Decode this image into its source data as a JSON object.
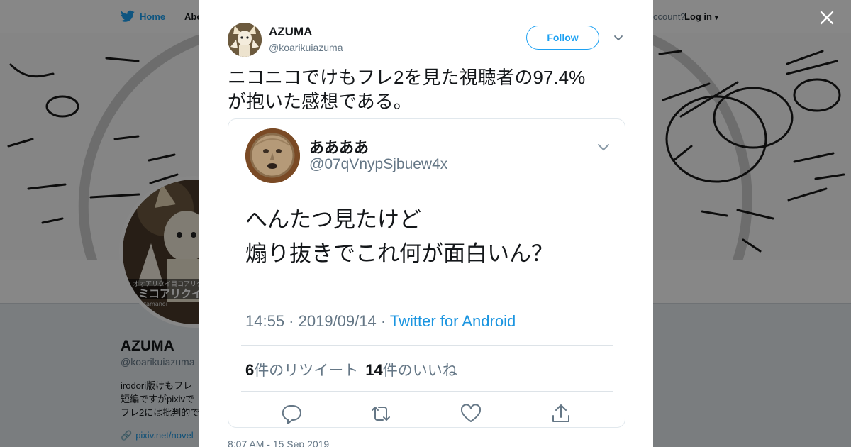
{
  "background": {
    "nav": {
      "home_label": "Home",
      "about_label": "Abo",
      "account_label": "ccount?",
      "login_label": "Log in"
    },
    "profile": {
      "avatar_caption_top": "オオアリクイ目コアリクイ属",
      "avatar_caption_main": "ミコアリクイ",
      "avatar_caption_sub": "tamanoi",
      "name": "AZUMA",
      "handle": "@koarikuiazuma",
      "bio_lines": [
        "irodori版けもフレ",
        "短編ですがpixivで",
        "フレ2には批判的で"
      ],
      "link": "pixiv.net/novel"
    }
  },
  "modal": {
    "author": {
      "name": "AZUMA",
      "handle": "@koarikuiazuma"
    },
    "follow_label": "Follow",
    "tweet_text_lines": [
      "ニコニコでけもフレ2を見た視聴者の97.4%",
      "が抱いた感想である。"
    ],
    "embedded_screenshot": {
      "name": "ああああ",
      "handle": "@07qVnypSjbuew4x",
      "text_lines": [
        "へんたつ見たけど",
        "煽り抜きでこれ何が面白いん？"
      ],
      "time": "14:55",
      "date": "2019/09/14",
      "via": "Twitter for Android",
      "retweets_count": "6",
      "retweets_label": "件のリツイート",
      "likes_count": "14",
      "likes_label": "件のいいね",
      "sep": " · "
    },
    "timestamp": "8:07 AM - 15 Sep 2019"
  },
  "colors": {
    "accent": "#1da1f2",
    "text": "#14171a",
    "secondary": "#657786"
  },
  "icons": [
    "twitter-bird-icon",
    "caret-down-icon",
    "close-icon",
    "reply-icon",
    "retweet-icon",
    "like-icon",
    "share-icon",
    "link-icon"
  ]
}
